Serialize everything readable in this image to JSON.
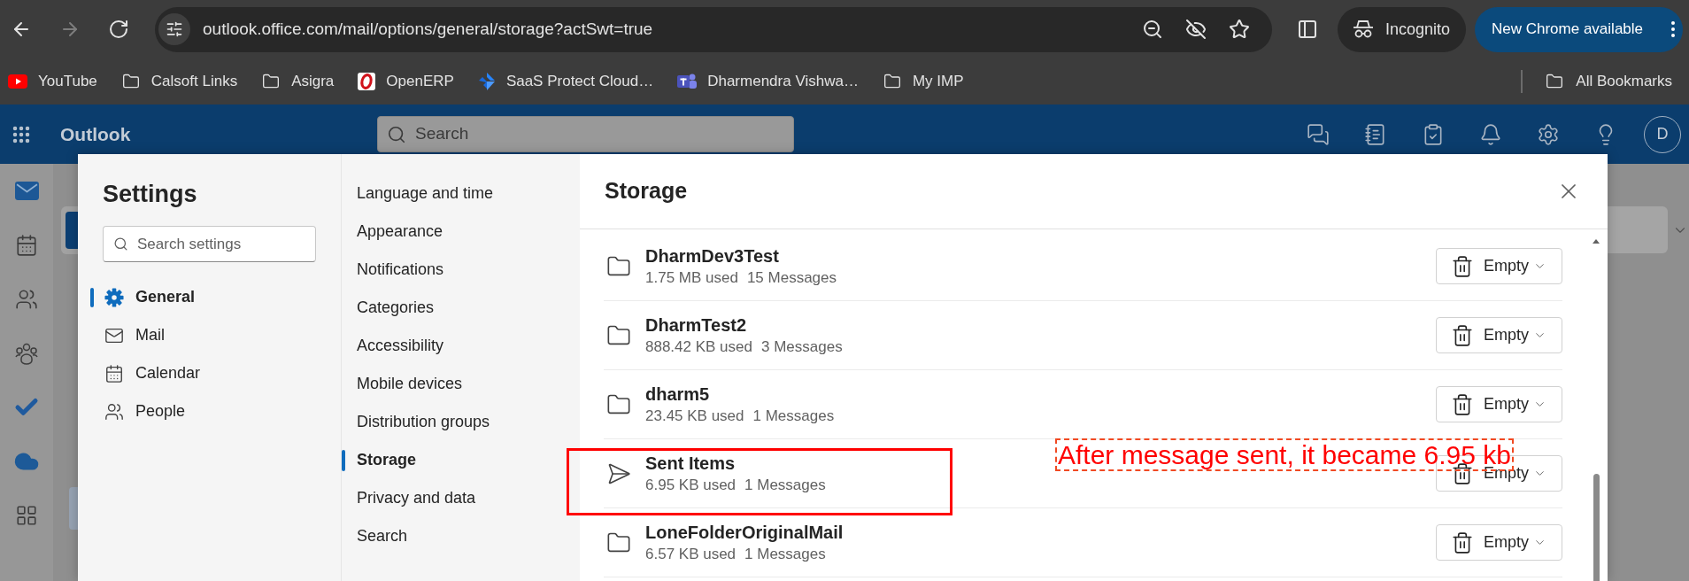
{
  "browser": {
    "nav": [
      {
        "kind": "back",
        "disabled": false
      },
      {
        "kind": "forward",
        "disabled": true
      },
      {
        "kind": "reload",
        "disabled": false
      }
    ],
    "url": "outlook.office.com/mail/options/general/storage?actSwt=true",
    "profile": "Incognito",
    "update_button": "New Chrome available"
  },
  "bookmarks": [
    {
      "kind": "site",
      "label": "YouTube"
    },
    {
      "kind": "folder",
      "label": "Calsoft Links"
    },
    {
      "kind": "folder",
      "label": "Asigra"
    },
    {
      "kind": "site",
      "label": "OpenERP"
    },
    {
      "kind": "site",
      "label": "SaaS Protect Cloud…"
    },
    {
      "kind": "site",
      "label": "Dharmendra Vishwa…"
    },
    {
      "kind": "folder",
      "label": "My IMP"
    }
  ],
  "all_bookmarks": "All Bookmarks",
  "outlook_header": {
    "app_name": "Outlook",
    "search": {
      "placeholder": "Search"
    },
    "avatar": "D"
  },
  "settings": {
    "title": "Settings",
    "search": {
      "placeholder": "Search settings"
    },
    "categories": [
      {
        "label": "General",
        "selected": true
      },
      {
        "label": "Mail",
        "selected": false
      },
      {
        "label": "Calendar",
        "selected": false
      },
      {
        "label": "People",
        "selected": false
      }
    ]
  },
  "general_menu": [
    {
      "label": "Language and time",
      "selected": false
    },
    {
      "label": "Appearance",
      "selected": false
    },
    {
      "label": "Notifications",
      "selected": false
    },
    {
      "label": "Categories",
      "selected": false
    },
    {
      "label": "Accessibility",
      "selected": false
    },
    {
      "label": "Mobile devices",
      "selected": false
    },
    {
      "label": "Distribution groups",
      "selected": false
    },
    {
      "label": "Storage",
      "selected": true
    },
    {
      "label": "Privacy and data",
      "selected": false
    },
    {
      "label": "Search",
      "selected": false
    }
  ],
  "storage": {
    "title": "Storage",
    "folders": [
      {
        "kind": "folder",
        "name": "DharmDev3Test",
        "size": "1.75 MB used",
        "messages": "15 Messages",
        "action": "Empty",
        "highlighted": false
      },
      {
        "kind": "folder",
        "name": "DharmTest2",
        "size": "888.42 KB used",
        "messages": "3 Messages",
        "action": "Empty",
        "highlighted": false
      },
      {
        "kind": "folder",
        "name": "dharm5",
        "size": "23.45 KB used",
        "messages": "1 Messages",
        "action": "Empty",
        "highlighted": false
      },
      {
        "kind": "sent",
        "name": "Sent Items",
        "size": "6.95 KB used",
        "messages": "1 Messages",
        "action": "Empty",
        "highlighted": true,
        "note": "After message sent, it became 6.95 kb"
      },
      {
        "kind": "folder",
        "name": "LoneFolderOriginalMail",
        "size": "6.57 KB used",
        "messages": "1 Messages",
        "action": "Empty",
        "highlighted": false
      }
    ]
  }
}
